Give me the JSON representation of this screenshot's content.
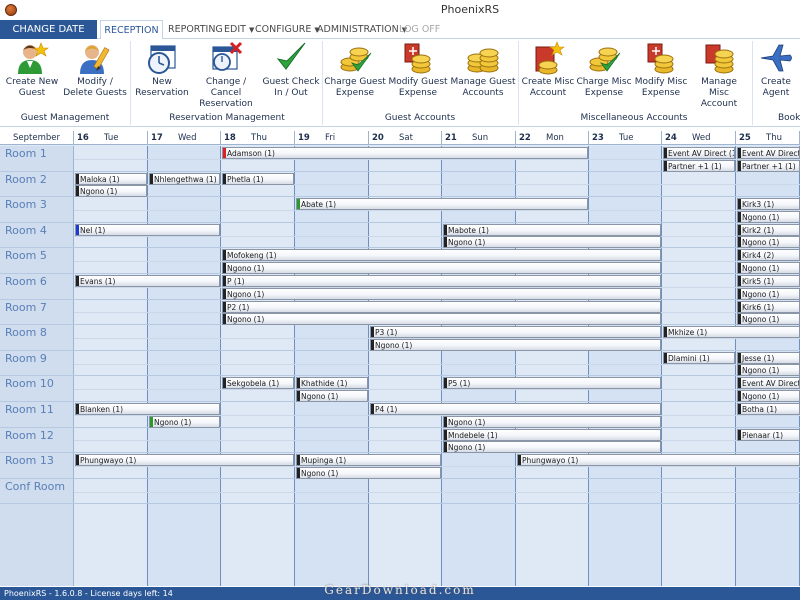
{
  "window": {
    "title": "PhoenixRS"
  },
  "menu": {
    "change_date": "CHANGE DATE",
    "tabs": [
      {
        "label": "RECEPTION",
        "active": true,
        "caret": false,
        "disabled": false
      },
      {
        "label": "REPORTING",
        "active": false,
        "caret": false,
        "disabled": false
      },
      {
        "label": "EDIT",
        "active": false,
        "caret": true,
        "disabled": false
      },
      {
        "label": "CONFIGURE",
        "active": false,
        "caret": true,
        "disabled": false
      },
      {
        "label": "ADMINISTRATION",
        "active": false,
        "caret": true,
        "disabled": false
      },
      {
        "label": "LOG OFF",
        "active": false,
        "caret": false,
        "disabled": true
      }
    ]
  },
  "ribbon": {
    "buttons": [
      {
        "label": "Create New Guest",
        "icon": "guest-star-icon"
      },
      {
        "label": "Modify / Delete Guests",
        "icon": "guest-pencil-icon"
      },
      {
        "label": "New Reservation",
        "icon": "calendar-clock-icon"
      },
      {
        "label": "Change / Cancel Reservation",
        "icon": "calendar-cancel-icon"
      },
      {
        "label": "Guest Check In / Out",
        "icon": "checkmark-icon"
      },
      {
        "label": "Charge Guest Expense",
        "icon": "coins-check-icon"
      },
      {
        "label": "Modify Guest Expense",
        "icon": "coins-book-icon"
      },
      {
        "label": "Manage Guest Accounts",
        "icon": "coins-stack-icon"
      },
      {
        "label": "Create Misc Account",
        "icon": "account-star-icon"
      },
      {
        "label": "Charge Misc Expense",
        "icon": "coins-check-icon"
      },
      {
        "label": "Modify Misc Expense",
        "icon": "coins-book-icon"
      },
      {
        "label": "Manage Misc Account",
        "icon": "coins-stack-icon"
      },
      {
        "label": "Create Agent",
        "icon": "airplane-icon"
      }
    ],
    "groups": [
      "Guest Management",
      "Reservation Management",
      "Guest Accounts",
      "Miscellaneous Accounts",
      "Book"
    ]
  },
  "calendar": {
    "month": "September",
    "days": [
      {
        "num": "16",
        "name": "Tue"
      },
      {
        "num": "17",
        "name": "Wed"
      },
      {
        "num": "18",
        "name": "Thu"
      },
      {
        "num": "19",
        "name": "Fri"
      },
      {
        "num": "20",
        "name": "Sat"
      },
      {
        "num": "21",
        "name": "Sun"
      },
      {
        "num": "22",
        "name": "Mon"
      },
      {
        "num": "23",
        "name": "Tue"
      },
      {
        "num": "24",
        "name": "Wed"
      },
      {
        "num": "25",
        "name": "Thu"
      }
    ],
    "rooms": [
      "Room 1",
      "Room 2",
      "Room 3",
      "Room 4",
      "Room 5",
      "Room 6",
      "Room 7",
      "Room 8",
      "Room 9",
      "Room 10",
      "Room 11",
      "Room 12",
      "Room 13",
      "Conf Room"
    ],
    "bookings": [
      {
        "label": "Adamson (1)",
        "room": 0,
        "sub": 0,
        "start": 2,
        "end": 6.99,
        "marker": "#e02020"
      },
      {
        "label": "Event AV Direct (1)",
        "room": 0,
        "sub": 0,
        "start": 8,
        "end": 8.99,
        "marker": "#222"
      },
      {
        "label": "Event AV Direct (1)",
        "room": 0,
        "sub": 0,
        "start": 9,
        "end": 10,
        "marker": "#222"
      },
      {
        "label": "Partner +1 (1)",
        "room": 0,
        "sub": 1,
        "start": 8,
        "end": 8.99,
        "marker": "#222"
      },
      {
        "label": "Partner +1 (1)",
        "room": 0,
        "sub": 1,
        "start": 9,
        "end": 10,
        "marker": "#222"
      },
      {
        "label": "Maloka (1)",
        "room": 1,
        "sub": 0,
        "start": 0,
        "end": 0.99,
        "marker": "#222"
      },
      {
        "label": "Nhlengethwa (1)",
        "room": 1,
        "sub": 0,
        "start": 1,
        "end": 1.99,
        "marker": "#222"
      },
      {
        "label": "Phetla (1)",
        "room": 1,
        "sub": 0,
        "start": 2,
        "end": 2.99,
        "marker": "#222"
      },
      {
        "label": "Ngono (1)",
        "room": 1,
        "sub": 1,
        "start": 0,
        "end": 0.99,
        "marker": "#222"
      },
      {
        "label": "Abate (1)",
        "room": 2,
        "sub": 0,
        "start": 3,
        "end": 6.99,
        "marker": "#2a9a2a"
      },
      {
        "label": "Kirk3 (1)",
        "room": 2,
        "sub": 0,
        "start": 9,
        "end": 10,
        "marker": "#222"
      },
      {
        "label": "Ngono (1)",
        "room": 2,
        "sub": 1,
        "start": 9,
        "end": 10,
        "marker": "#222"
      },
      {
        "label": "Nel (1)",
        "room": 3,
        "sub": 0,
        "start": 0,
        "end": 1.99,
        "marker": "#1a3ad0"
      },
      {
        "label": "Mabote (1)",
        "room": 3,
        "sub": 0,
        "start": 5,
        "end": 7.99,
        "marker": "#222"
      },
      {
        "label": "Kirk2 (1)",
        "room": 3,
        "sub": 0,
        "start": 9,
        "end": 10,
        "marker": "#222"
      },
      {
        "label": "Ngono (1)",
        "room": 3,
        "sub": 1,
        "start": 5,
        "end": 7.99,
        "marker": "#222"
      },
      {
        "label": "Ngono (1)",
        "room": 3,
        "sub": 1,
        "start": 9,
        "end": 10,
        "marker": "#222"
      },
      {
        "label": "Mofokeng (1)",
        "room": 4,
        "sub": 0,
        "start": 2,
        "end": 7.99,
        "marker": "#222"
      },
      {
        "label": "Kirk4 (2)",
        "room": 4,
        "sub": 0,
        "start": 9,
        "end": 10,
        "marker": "#222"
      },
      {
        "label": "Ngono (1)",
        "room": 4,
        "sub": 1,
        "start": 2,
        "end": 7.99,
        "marker": "#222"
      },
      {
        "label": "Ngono (1)",
        "room": 4,
        "sub": 1,
        "start": 9,
        "end": 10,
        "marker": "#222"
      },
      {
        "label": "Evans (1)",
        "room": 5,
        "sub": 0,
        "start": 0,
        "end": 1.99,
        "marker": "#222"
      },
      {
        "label": "P (1)",
        "room": 5,
        "sub": 0,
        "start": 2,
        "end": 7.99,
        "marker": "#222"
      },
      {
        "label": "Kirk5 (1)",
        "room": 5,
        "sub": 0,
        "start": 9,
        "end": 10,
        "marker": "#222"
      },
      {
        "label": "Ngono (1)",
        "room": 5,
        "sub": 1,
        "start": 2,
        "end": 7.99,
        "marker": "#222"
      },
      {
        "label": "Ngono (1)",
        "room": 5,
        "sub": 1,
        "start": 9,
        "end": 10,
        "marker": "#222"
      },
      {
        "label": "P2 (1)",
        "room": 6,
        "sub": 0,
        "start": 2,
        "end": 7.99,
        "marker": "#222"
      },
      {
        "label": "Kirk6 (1)",
        "room": 6,
        "sub": 0,
        "start": 9,
        "end": 10,
        "marker": "#222"
      },
      {
        "label": "Ngono (1)",
        "room": 6,
        "sub": 1,
        "start": 2,
        "end": 7.99,
        "marker": "#222"
      },
      {
        "label": "Ngono (1)",
        "room": 6,
        "sub": 1,
        "start": 9,
        "end": 10,
        "marker": "#222"
      },
      {
        "label": "P3 (1)",
        "room": 7,
        "sub": 0,
        "start": 4,
        "end": 7.99,
        "marker": "#222"
      },
      {
        "label": "Mkhize (1)",
        "room": 7,
        "sub": 0,
        "start": 8,
        "end": 10,
        "marker": "#222"
      },
      {
        "label": "Ngono (1)",
        "room": 7,
        "sub": 1,
        "start": 4,
        "end": 7.99,
        "marker": "#222"
      },
      {
        "label": "Dlamini (1)",
        "room": 8,
        "sub": 0,
        "start": 8,
        "end": 8.99,
        "marker": "#222"
      },
      {
        "label": "Jesse (1)",
        "room": 8,
        "sub": 0,
        "start": 9,
        "end": 10,
        "marker": "#222"
      },
      {
        "label": "Ngono (1)",
        "room": 8,
        "sub": 1,
        "start": 9,
        "end": 10,
        "marker": "#222"
      },
      {
        "label": "Sekgobela (1)",
        "room": 9,
        "sub": 0,
        "start": 2,
        "end": 2.99,
        "marker": "#222"
      },
      {
        "label": "Khathide (1)",
        "room": 9,
        "sub": 0,
        "start": 3,
        "end": 3.99,
        "marker": "#222"
      },
      {
        "label": "P5 (1)",
        "room": 9,
        "sub": 0,
        "start": 5,
        "end": 7.99,
        "marker": "#222"
      },
      {
        "label": "Event AV Direct (1)",
        "room": 9,
        "sub": 0,
        "start": 9,
        "end": 10,
        "marker": "#222"
      },
      {
        "label": "Ngono (1)",
        "room": 9,
        "sub": 1,
        "start": 3,
        "end": 3.99,
        "marker": "#222"
      },
      {
        "label": "Ngono (1)",
        "room": 9,
        "sub": 1,
        "start": 9,
        "end": 10,
        "marker": "#222"
      },
      {
        "label": "Blanken (1)",
        "room": 10,
        "sub": 0,
        "start": 0,
        "end": 1.99,
        "marker": "#222"
      },
      {
        "label": "P4 (1)",
        "room": 10,
        "sub": 0,
        "start": 4,
        "end": 7.99,
        "marker": "#222"
      },
      {
        "label": "Botha (1)",
        "room": 10,
        "sub": 0,
        "start": 9,
        "end": 10,
        "marker": "#222"
      },
      {
        "label": "Ngono (1)",
        "room": 10,
        "sub": 1,
        "start": 1,
        "end": 1.99,
        "marker": "#2a9a2a"
      },
      {
        "label": "Ngono (1)",
        "room": 10,
        "sub": 1,
        "start": 5,
        "end": 7.99,
        "marker": "#222"
      },
      {
        "label": "Mndebele (1)",
        "room": 11,
        "sub": 0,
        "start": 5,
        "end": 7.99,
        "marker": "#222"
      },
      {
        "label": "Pienaar (1)",
        "room": 11,
        "sub": 0,
        "start": 9,
        "end": 10,
        "marker": "#222"
      },
      {
        "label": "Ngono (1)",
        "room": 11,
        "sub": 1,
        "start": 5,
        "end": 7.99,
        "marker": "#222"
      },
      {
        "label": "Phungwayo (1)",
        "room": 12,
        "sub": 0,
        "start": 0,
        "end": 2.99,
        "marker": "#222"
      },
      {
        "label": "Mupinga (1)",
        "room": 12,
        "sub": 0,
        "start": 3,
        "end": 4.99,
        "marker": "#222"
      },
      {
        "label": "Phungwayo (1)",
        "room": 12,
        "sub": 0,
        "start": 6,
        "end": 10,
        "marker": "#222"
      },
      {
        "label": "Ngono (1)",
        "room": 12,
        "sub": 1,
        "start": 3,
        "end": 4.99,
        "marker": "#222"
      }
    ]
  },
  "status": {
    "text": "PhoenixRS - 1.6.0.8 - License days left: 14",
    "watermark": "GearDownload.com"
  }
}
